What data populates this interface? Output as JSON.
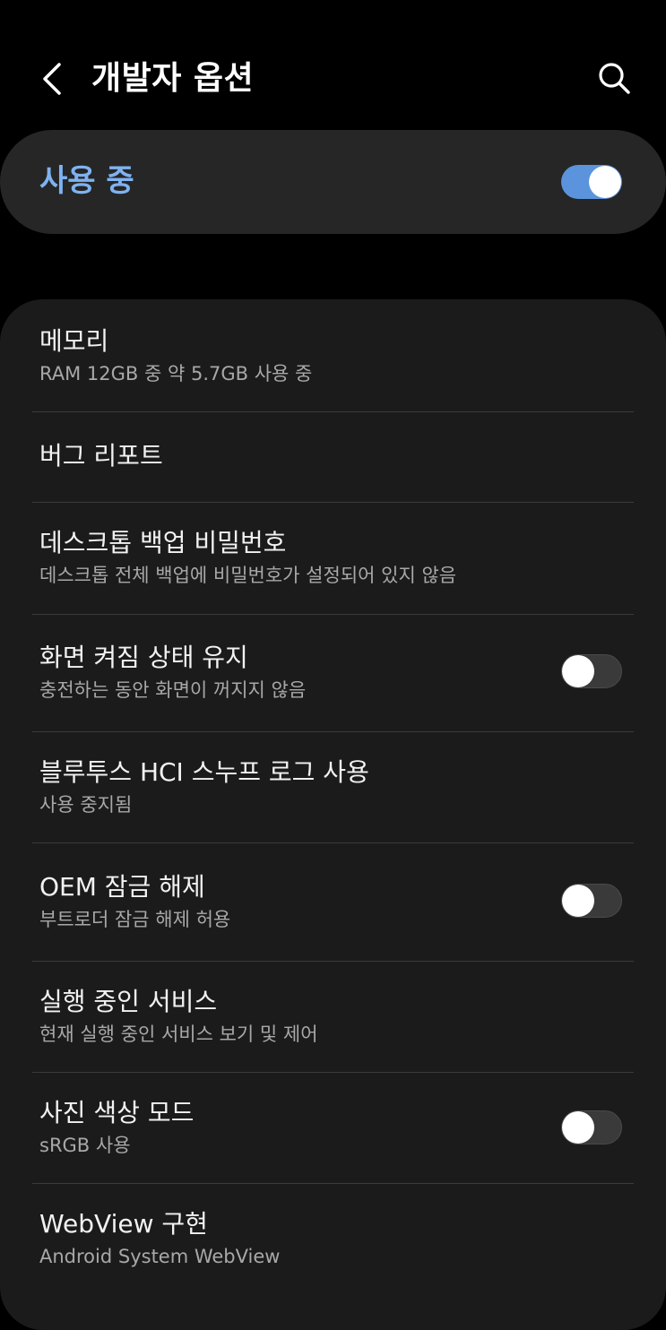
{
  "header": {
    "title": "개발자 옵션",
    "back_icon": "chevron-left-icon",
    "search_icon": "search-icon"
  },
  "master": {
    "label": "사용 중",
    "enabled": true,
    "accent_color": "#7fb2f0"
  },
  "items": [
    {
      "title": "메모리",
      "summary": "RAM 12GB 중 약 5.7GB 사용 중"
    },
    {
      "title": "버그 리포트"
    },
    {
      "title": "데스크톱 백업 비밀번호",
      "summary": "데스크톱 전체 백업에 비밀번호가 설정되어 있지 않음"
    },
    {
      "title": "화면 켜짐 상태 유지",
      "summary": "충전하는 동안 화면이 꺼지지 않음",
      "switch": false
    },
    {
      "title": "블루투스 HCI 스누프 로그 사용",
      "summary": "사용 중지됨"
    },
    {
      "title": "OEM 잠금 해제",
      "summary": "부트로더 잠금 해제 허용",
      "switch": false
    },
    {
      "title": "실행 중인 서비스",
      "summary": "현재 실행 중인 서비스 보기 및 제어"
    },
    {
      "title": "사진 색상 모드",
      "summary": "sRGB 사용",
      "switch": false
    },
    {
      "title": "WebView 구현",
      "summary": "Android System WebView"
    }
  ]
}
